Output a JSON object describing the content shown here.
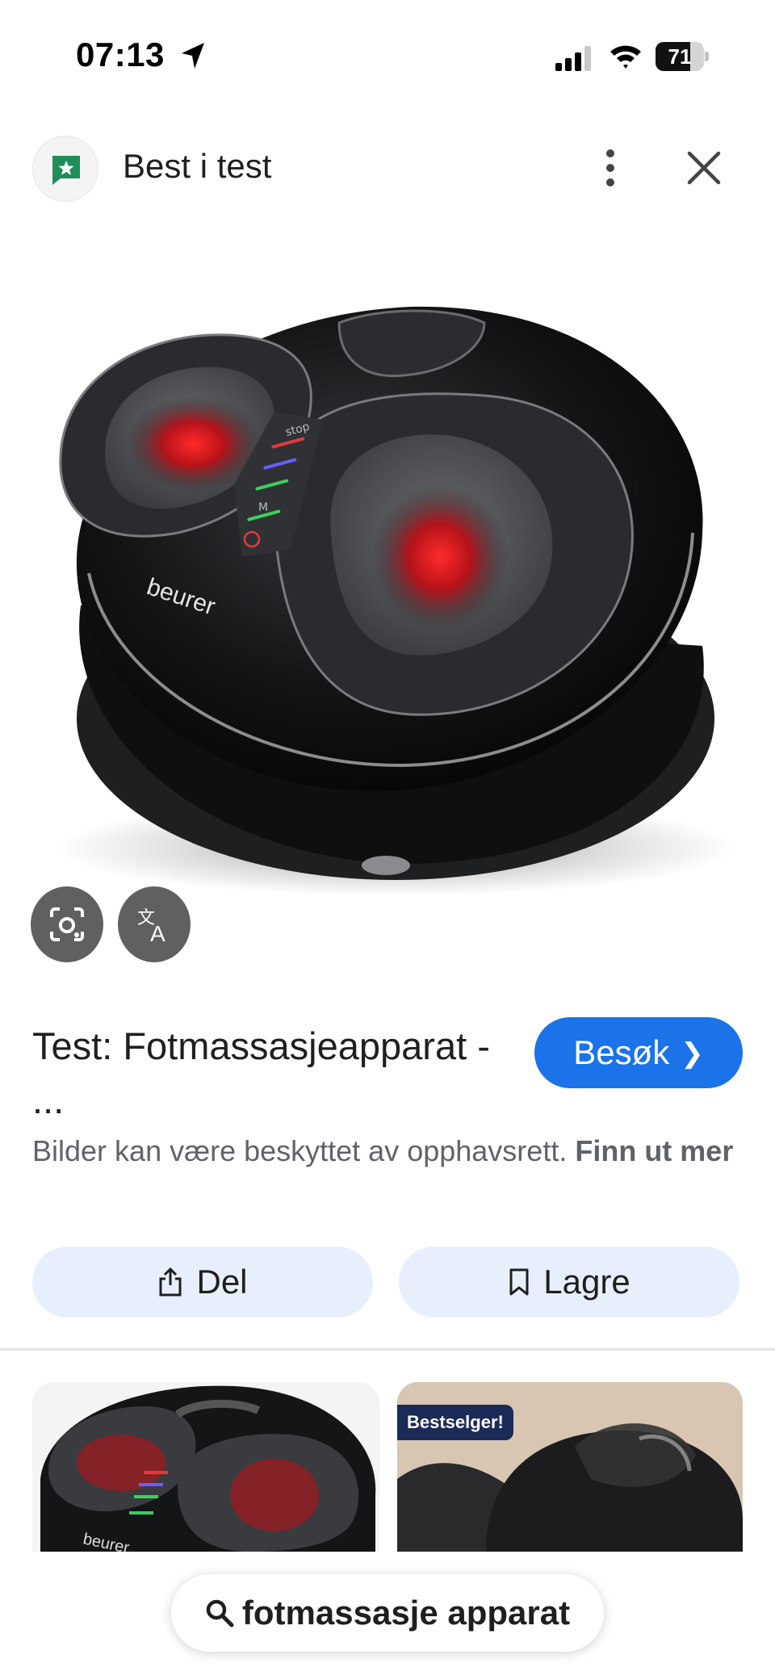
{
  "status_bar": {
    "time": "07:13",
    "battery_percent": "71",
    "battery_level": 0.71,
    "icons": [
      "location-arrow-icon",
      "signal-icon",
      "wifi-icon",
      "battery-icon"
    ]
  },
  "header": {
    "title": "Best i test",
    "icons": [
      "site-favicon-icon",
      "more-vert-icon",
      "close-icon"
    ]
  },
  "image": {
    "brand_text": "beurer",
    "panel_labels": [
      "stop",
      "M"
    ],
    "tools": [
      "google-lens-icon",
      "translate-icon"
    ]
  },
  "result": {
    "title": "Test: Fotmassasjeapparat - ...",
    "visit_label": "Besøk",
    "copyright_text": "Bilder kan være beskyttet av opphavsrett.",
    "learn_more": "Finn ut mer"
  },
  "actions": {
    "share_label": "Del",
    "save_label": "Lagre"
  },
  "related": {
    "thumb_1_brand": "beurer",
    "badge": "Bestselger!"
  },
  "search": {
    "query": "fotmassasje apparat"
  },
  "colors": {
    "accent": "#1a73e8",
    "pill_bg": "#e8effc",
    "fab_bg": "#5f6060",
    "badge_bg": "#1b2a57",
    "light_red": "#e3262b",
    "favicon_green": "#1e8e5a"
  }
}
